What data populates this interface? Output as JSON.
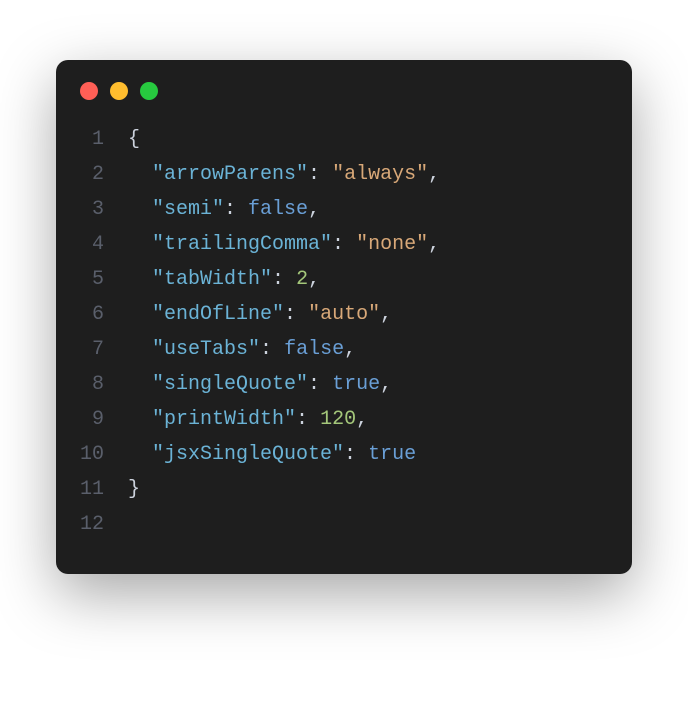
{
  "titlebar": {
    "dots": [
      "red",
      "yellow",
      "green"
    ]
  },
  "gutter": {
    "l1": "1",
    "l2": "2",
    "l3": "3",
    "l4": "4",
    "l5": "5",
    "l6": "6",
    "l7": "7",
    "l8": "8",
    "l9": "9",
    "l10": "10",
    "l11": "11",
    "l12": "12"
  },
  "code": {
    "openBrace": "{",
    "closeBrace": "}",
    "indent": "  ",
    "colon": ": ",
    "comma": ",",
    "keys": {
      "arrowParens": "\"arrowParens\"",
      "semi": "\"semi\"",
      "trailingComma": "\"trailingComma\"",
      "tabWidth": "\"tabWidth\"",
      "endOfLine": "\"endOfLine\"",
      "useTabs": "\"useTabs\"",
      "singleQuote": "\"singleQuote\"",
      "printWidth": "\"printWidth\"",
      "jsxSingleQuote": "\"jsxSingleQuote\""
    },
    "values": {
      "arrowParens": "\"always\"",
      "semi": "false",
      "trailingComma": "\"none\"",
      "tabWidth": "2",
      "endOfLine": "\"auto\"",
      "useTabs": "false",
      "singleQuote": "true",
      "printWidth": "120",
      "jsxSingleQuote": "true"
    }
  }
}
